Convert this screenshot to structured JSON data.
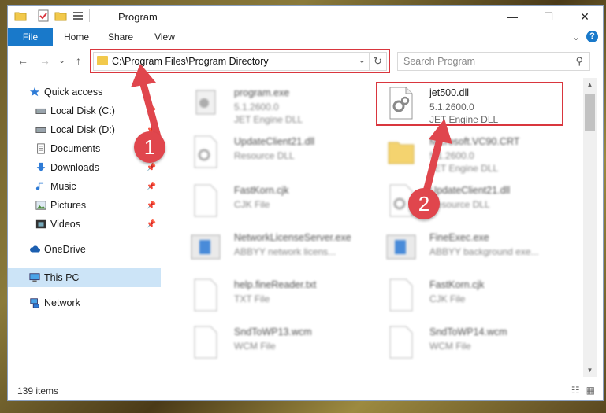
{
  "window": {
    "title": "Program"
  },
  "title_controls": {
    "minimize": "—",
    "maximize": "☐",
    "close": "✕"
  },
  "ribbon": {
    "tabs": [
      "File",
      "Home",
      "Share",
      "View"
    ],
    "expand": "⌄",
    "help": "?"
  },
  "nav": {
    "back": "←",
    "forward": "→",
    "recent": "⌄",
    "up": "↑"
  },
  "address": {
    "path": "C:\\Program Files\\Program Directory",
    "dropdown": "⌄",
    "refresh": "↻"
  },
  "search": {
    "placeholder": "Search Program",
    "icon": "⚲"
  },
  "sidebar": {
    "items": [
      {
        "label": "Quick access",
        "icon": "star-icon",
        "pinned": false
      },
      {
        "label": "Local Disk (C:)",
        "icon": "drive-icon",
        "pinned": true
      },
      {
        "label": "Local Disk (D:)",
        "icon": "drive-icon",
        "pinned": true
      },
      {
        "label": "Documents",
        "icon": "documents-icon",
        "pinned": true
      },
      {
        "label": "Downloads",
        "icon": "download-icon",
        "pinned": true
      },
      {
        "label": "Music",
        "icon": "music-icon",
        "pinned": true
      },
      {
        "label": "Pictures",
        "icon": "pictures-icon",
        "pinned": true
      },
      {
        "label": "Videos",
        "icon": "videos-icon",
        "pinned": true
      },
      {
        "label": "OneDrive",
        "icon": "cloud-icon",
        "pinned": false
      },
      {
        "label": "This PC",
        "icon": "computer-icon",
        "pinned": false
      },
      {
        "label": "Network",
        "icon": "network-icon",
        "pinned": false
      }
    ],
    "pin_glyph": "📌"
  },
  "files": [
    {
      "name": "program.exe",
      "line2": "5.1.2600.0",
      "line3": "JET Engine DLL",
      "type": "exe"
    },
    {
      "name": "jet500.dll",
      "line2": "5.1.2600.0",
      "line3": "JET Engine DLL",
      "type": "dll"
    },
    {
      "name": "UpdateClient21.dll",
      "line2": "Resource DLL",
      "line3": "",
      "type": "dll"
    },
    {
      "name": "Microsoft.VC90.CRT",
      "line2": "5.1.2600.0",
      "line3": "JET Engine DLL",
      "type": "folder"
    },
    {
      "name": "FastKorn.cjk",
      "line2": "CJK File",
      "line3": "",
      "type": "file"
    },
    {
      "name": "UpdateClient21.dll",
      "line2": "Resource DLL",
      "line3": "",
      "type": "dll"
    },
    {
      "name": "NetworkLicenseServer.exe",
      "line2": "ABBYY network licens...",
      "line3": "",
      "type": "app"
    },
    {
      "name": "FineExec.exe",
      "line2": "ABBYY background exe...",
      "line3": "",
      "type": "app"
    },
    {
      "name": "help.fineReader.txt",
      "line2": "TXT File",
      "line3": "",
      "type": "file"
    },
    {
      "name": "FastKorn.cjk",
      "line2": "CJK File",
      "line3": "",
      "type": "file"
    },
    {
      "name": "SndToWP13.wcm",
      "line2": "WCM File",
      "line3": "",
      "type": "file"
    },
    {
      "name": "SndToWP14.wcm",
      "line2": "WCM File",
      "line3": "",
      "type": "file"
    }
  ],
  "status": {
    "count": "139 items",
    "details_view": "☷",
    "tiles_view": "▦"
  },
  "annotations": {
    "badge1": "1",
    "badge2": "2",
    "color": "#d9363e"
  },
  "scroll": {
    "up": "▲",
    "down": "▼"
  }
}
